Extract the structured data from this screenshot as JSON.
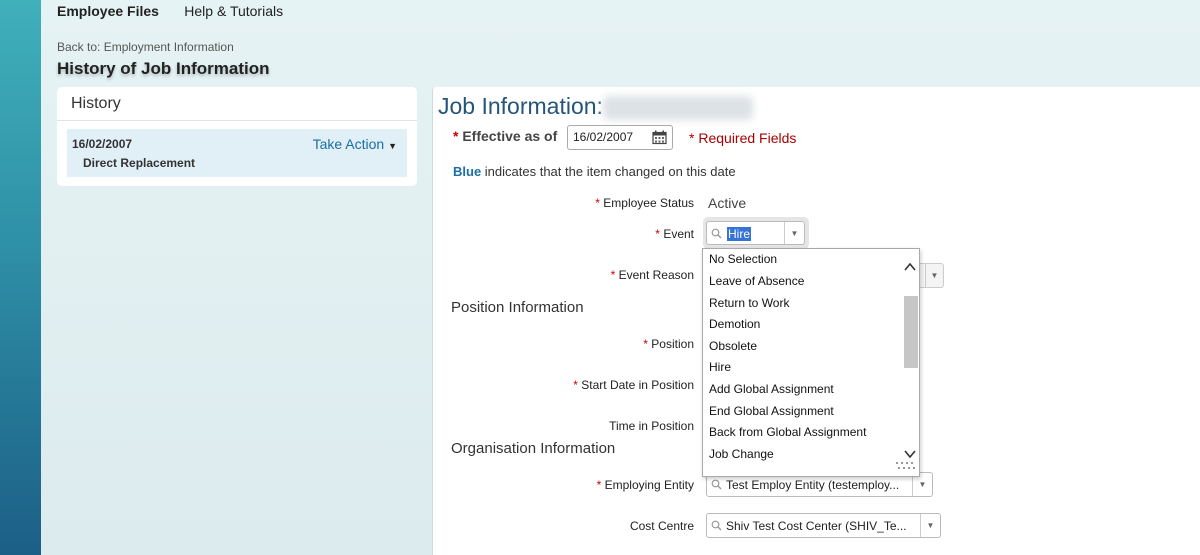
{
  "nav": {
    "items": [
      "Employee Files",
      "Help & Tutorials"
    ]
  },
  "back_link": "Back to: Employment Information",
  "page_title": "History of Job Information",
  "history": {
    "heading": "History",
    "entry": {
      "date": "16/02/2007",
      "event": "Direct Replacement",
      "action_label": "Take Action"
    }
  },
  "job": {
    "title": "Job Information:",
    "effective_label": "Effective as of",
    "effective_value": "16/02/2007",
    "required_note": "Required Fields",
    "required_marker": "*",
    "blue_word": "Blue",
    "blue_note": "indicates that the item changed on this date",
    "fields": {
      "employee_status": {
        "label": "Employee Status",
        "value": "Active"
      },
      "event": {
        "label": "Event",
        "value": "Hire"
      },
      "event_reason": {
        "label": "Event Reason"
      },
      "position": {
        "label": "Position"
      },
      "start_date": {
        "label": "Start Date in Position"
      },
      "time_in_position": {
        "label": "Time in Position"
      },
      "employing_entity": {
        "label": "Employing Entity",
        "value": "Test Employ Entity (testemploy..."
      },
      "cost_centre": {
        "label": "Cost Centre",
        "value": "Shiv Test Cost Center (SHIV_Te..."
      }
    },
    "sections": {
      "position": "Position Information",
      "organisation": "Organisation Information"
    }
  },
  "event_dropdown": {
    "options": [
      "No Selection",
      "Leave of Absence",
      "Return to Work",
      "Demotion",
      "Obsolete",
      "Hire",
      "Add Global Assignment",
      "End Global Assignment",
      "Back from Global Assignment",
      "Job Change"
    ]
  },
  "colors": {
    "accent": "#1a6fa3",
    "title": "#24557a",
    "required": "#cc0000",
    "selection": "#3574d6"
  }
}
